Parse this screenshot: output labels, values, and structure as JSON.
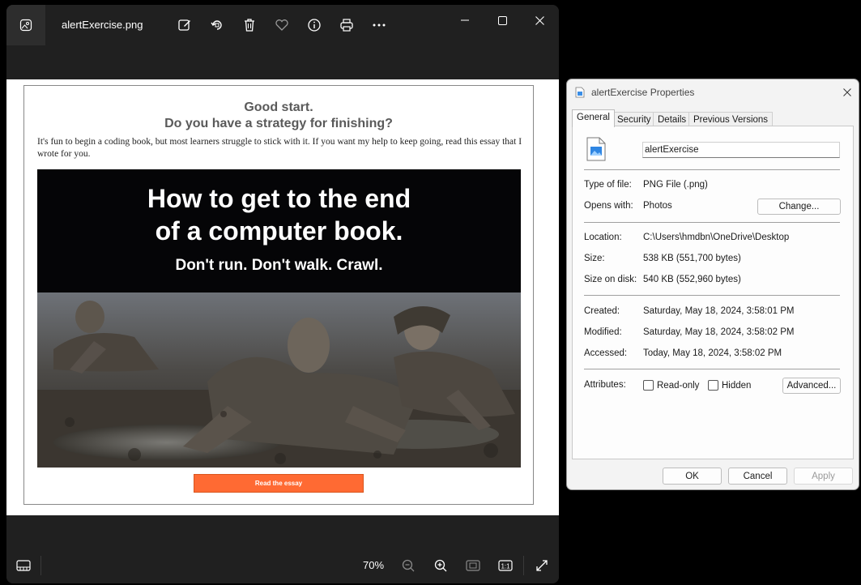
{
  "photos": {
    "filename": "alertExercise.png",
    "zoom": "70%",
    "toolbar": [
      "edit-image-icon",
      "rotate-icon",
      "delete-icon",
      "favorite-icon",
      "info-icon",
      "print-icon",
      "more-icon"
    ],
    "window_controls": [
      "minimize-icon",
      "maximize-icon",
      "close-icon"
    ],
    "email": {
      "heading_line1": "Good start.",
      "heading_line2": "Do you have a strategy for finishing?",
      "paragraph": "It's fun to begin a coding book, but most learners struggle to stick with it. If you want my help to keep going, read this essay that I wrote for you.",
      "banner_line1": "How to get to the end",
      "banner_line2": "of a computer book.",
      "banner_line3": "Don't run. Don't walk. Crawl.",
      "cta": "Read the essay"
    }
  },
  "properties": {
    "title": "alertExercise Properties",
    "tabs": [
      "General",
      "Security",
      "Details",
      "Previous Versions"
    ],
    "active_tab": "General",
    "filename": "alertExercise",
    "type_of_file_label": "Type of file:",
    "type_of_file": "PNG File (.png)",
    "opens_with_label": "Opens with:",
    "opens_with": "Photos",
    "change_button": "Change...",
    "location_label": "Location:",
    "location": "C:\\Users\\hmdbn\\OneDrive\\Desktop",
    "size_label": "Size:",
    "size": "538 KB (551,700 bytes)",
    "size_on_disk_label": "Size on disk:",
    "size_on_disk": "540 KB (552,960 bytes)",
    "created_label": "Created:",
    "created": "Saturday, May 18, 2024, 3:58:01 PM",
    "modified_label": "Modified:",
    "modified": "Saturday, May 18, 2024, 3:58:02 PM",
    "accessed_label": "Accessed:",
    "accessed": "Today, May 18, 2024, 3:58:02 PM",
    "attributes_label": "Attributes:",
    "readonly_label": "Read-only",
    "hidden_label": "Hidden",
    "advanced_button": "Advanced...",
    "ok_button": "OK",
    "cancel_button": "Cancel",
    "apply_button": "Apply"
  }
}
